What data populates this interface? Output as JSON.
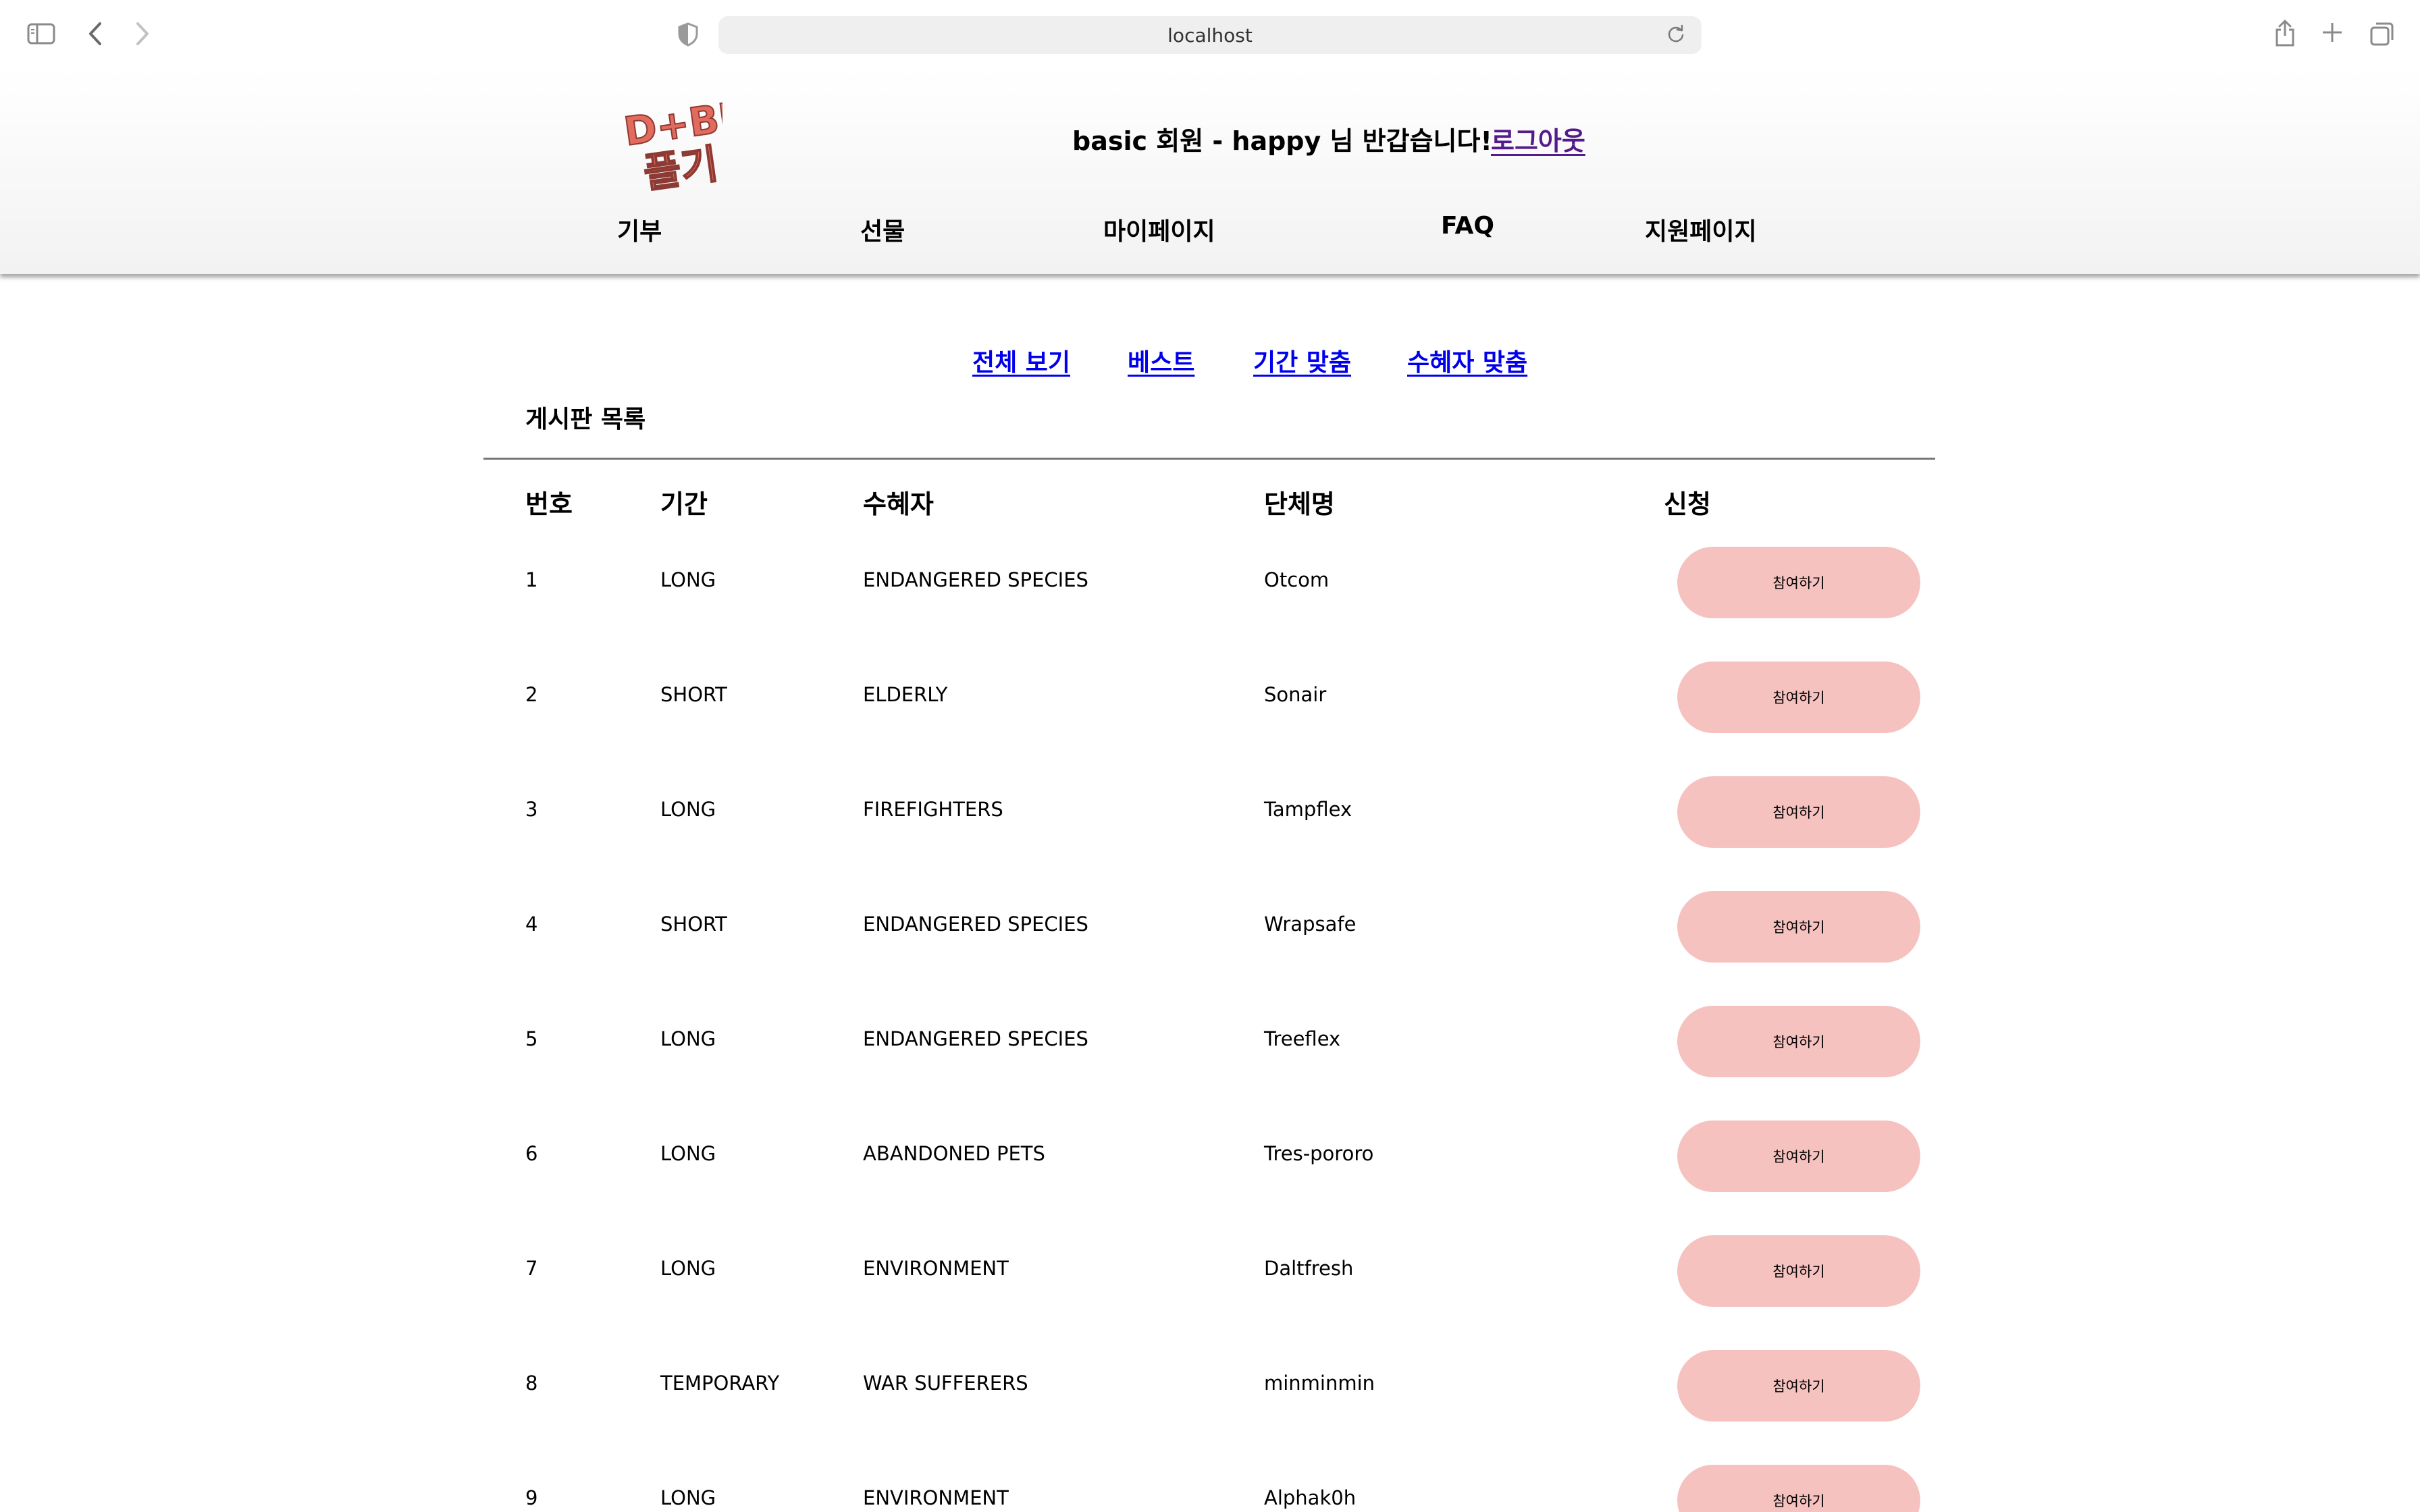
{
  "browser": {
    "url": "localhost",
    "icons": [
      "sidebar-icon",
      "back-icon",
      "forward-icon",
      "shield-icon",
      "reload-icon",
      "share-icon",
      "plus-icon",
      "tabs-icon"
    ]
  },
  "header": {
    "logo_text_top": "D+BH",
    "logo_text_bottom": "플기",
    "greeting": "basic 회원 - happy 님 반갑습니다!",
    "logout": "로그아웃"
  },
  "nav": [
    "기부",
    "선물",
    "마이페이지",
    "FAQ",
    "지원페이지"
  ],
  "subnav": [
    "전체 보기",
    "베스트",
    "기간 맞춤",
    "수혜자 맞춤"
  ],
  "board": {
    "title": "게시판 목록",
    "columns": [
      "번호",
      "기간",
      "수혜자",
      "단체명",
      "신청"
    ],
    "apply_label": "참여하기",
    "rows": [
      {
        "no": "1",
        "period": "LONG",
        "target": "ENDANGERED SPECIES",
        "org": "Otcom"
      },
      {
        "no": "2",
        "period": "SHORT",
        "target": "ELDERLY",
        "org": "Sonair"
      },
      {
        "no": "3",
        "period": "LONG",
        "target": "FIREFIGHTERS",
        "org": "Tampflex"
      },
      {
        "no": "4",
        "period": "SHORT",
        "target": "ENDANGERED SPECIES",
        "org": "Wrapsafe"
      },
      {
        "no": "5",
        "period": "LONG",
        "target": "ENDANGERED SPECIES",
        "org": "Treeflex"
      },
      {
        "no": "6",
        "period": "LONG",
        "target": "ABANDONED PETS",
        "org": "Tres-pororo"
      },
      {
        "no": "7",
        "period": "LONG",
        "target": "ENVIRONMENT",
        "org": "Daltfresh"
      },
      {
        "no": "8",
        "period": "TEMPORARY",
        "target": "WAR SUFFERERS",
        "org": "minminmin"
      },
      {
        "no": "9",
        "period": "LONG",
        "target": "ENVIRONMENT",
        "org": "Alphak0h"
      }
    ]
  },
  "colors": {
    "button_bg": "#f5c2c0",
    "link_blue": "#0000ee",
    "visited_purple": "#551a8b",
    "logo_red": "#e26b5e"
  }
}
